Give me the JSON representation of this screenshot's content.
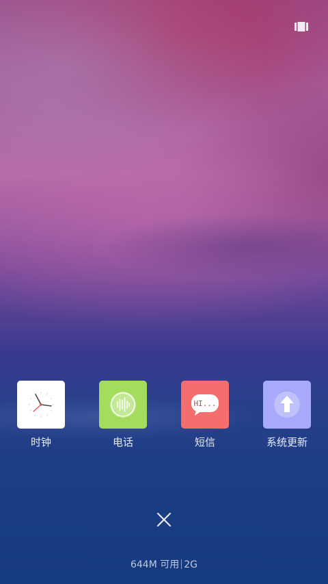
{
  "top_bar": {
    "icon": "recents-layout-icon"
  },
  "apps": [
    {
      "label": "时钟",
      "icon": "clock-icon",
      "tile_color": "#ffffff"
    },
    {
      "label": "电话",
      "icon": "phone-icon",
      "tile_color": "#a4dd5e"
    },
    {
      "label": "短信",
      "icon": "message-icon",
      "tile_color": "#f56e6e",
      "icon_text": "HI..."
    },
    {
      "label": "系统更新",
      "icon": "system-update-icon",
      "tile_color": "#a9a9fb"
    }
  ],
  "close": {
    "icon": "close-icon"
  },
  "memory": {
    "available": "644M 可用",
    "total": "2G"
  }
}
